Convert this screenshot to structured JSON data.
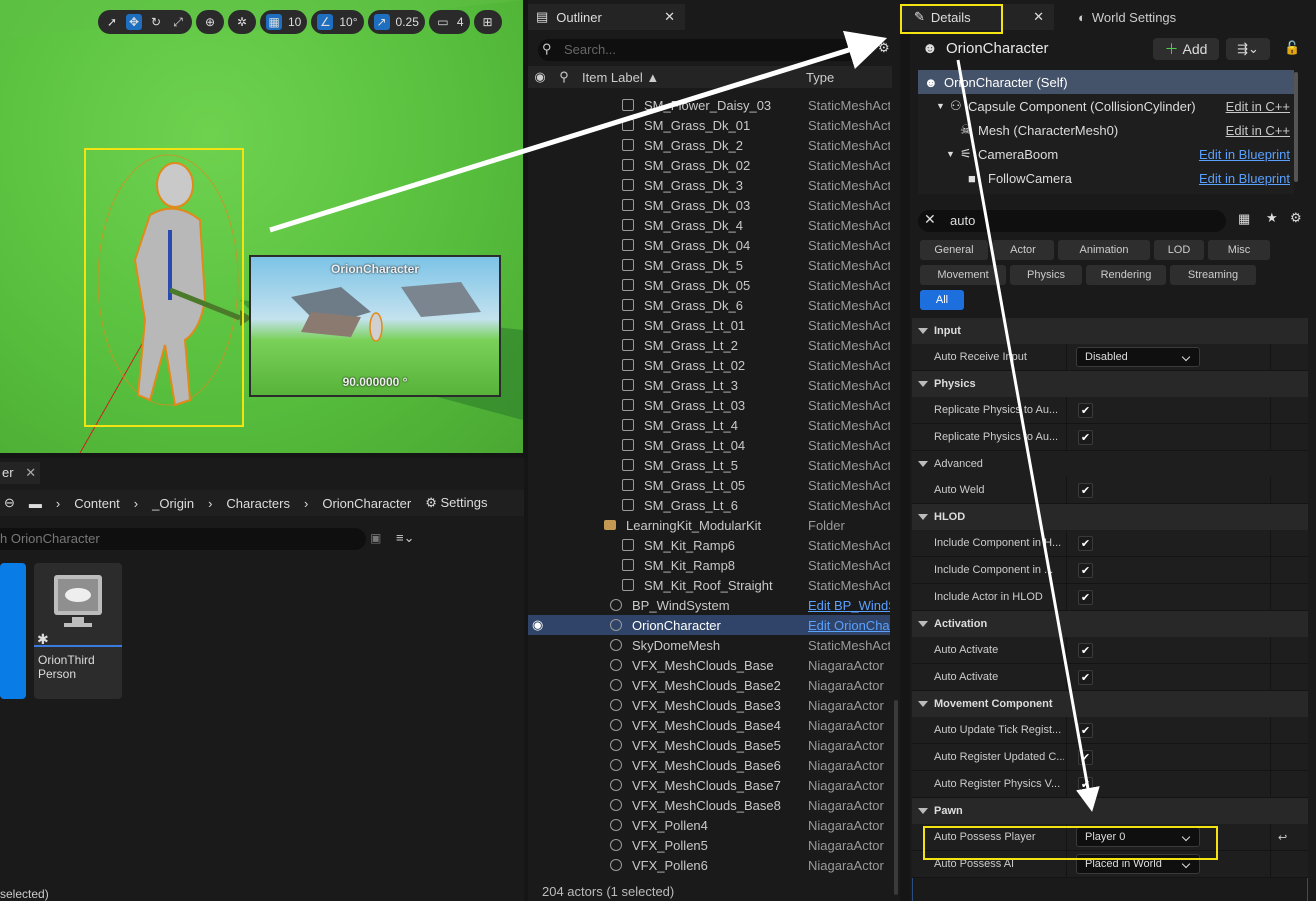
{
  "viewport": {
    "toolbar": {
      "grid_value": "10",
      "angle_value": "10°",
      "scale_value": "0.25",
      "camera_speed": "4"
    },
    "pip": {
      "title": "OrionCharacter",
      "angle": "90.000000 °"
    }
  },
  "content_browser": {
    "tab": "er",
    "path": [
      "Content",
      "_Origin",
      "Characters",
      "OrionCharacter"
    ],
    "settings_label": "Settings",
    "search_placeholder": "h OrionCharacter",
    "asset_label": "OrionThird Person",
    "status": "selected)"
  },
  "outliner": {
    "tab_title": "Outliner",
    "search_placeholder": "Search...",
    "col_label": "Item Label",
    "col_type": "Type",
    "rows": [
      {
        "name": "SM_Flower_Daisy_03",
        "type": "StaticMeshAct"
      },
      {
        "name": "SM_Grass_Dk_01",
        "type": "StaticMeshAct"
      },
      {
        "name": "SM_Grass_Dk_2",
        "type": "StaticMeshAct"
      },
      {
        "name": "SM_Grass_Dk_02",
        "type": "StaticMeshAct"
      },
      {
        "name": "SM_Grass_Dk_3",
        "type": "StaticMeshAct"
      },
      {
        "name": "SM_Grass_Dk_03",
        "type": "StaticMeshAct"
      },
      {
        "name": "SM_Grass_Dk_4",
        "type": "StaticMeshAct"
      },
      {
        "name": "SM_Grass_Dk_04",
        "type": "StaticMeshAct"
      },
      {
        "name": "SM_Grass_Dk_5",
        "type": "StaticMeshAct"
      },
      {
        "name": "SM_Grass_Dk_05",
        "type": "StaticMeshAct"
      },
      {
        "name": "SM_Grass_Dk_6",
        "type": "StaticMeshAct"
      },
      {
        "name": "SM_Grass_Lt_01",
        "type": "StaticMeshAct"
      },
      {
        "name": "SM_Grass_Lt_2",
        "type": "StaticMeshAct"
      },
      {
        "name": "SM_Grass_Lt_02",
        "type": "StaticMeshAct"
      },
      {
        "name": "SM_Grass_Lt_3",
        "type": "StaticMeshAct"
      },
      {
        "name": "SM_Grass_Lt_03",
        "type": "StaticMeshAct"
      },
      {
        "name": "SM_Grass_Lt_4",
        "type": "StaticMeshAct"
      },
      {
        "name": "SM_Grass_Lt_04",
        "type": "StaticMeshAct"
      },
      {
        "name": "SM_Grass_Lt_5",
        "type": "StaticMeshAct"
      },
      {
        "name": "SM_Grass_Lt_05",
        "type": "StaticMeshAct"
      },
      {
        "name": "SM_Grass_Lt_6",
        "type": "StaticMeshAct"
      },
      {
        "name": "LearningKit_ModularKit",
        "type": "Folder"
      },
      {
        "name": "SM_Kit_Ramp6",
        "type": "StaticMeshAct"
      },
      {
        "name": "SM_Kit_Ramp8",
        "type": "StaticMeshAct"
      },
      {
        "name": "SM_Kit_Roof_Straight",
        "type": "StaticMeshAct"
      },
      {
        "name": "BP_WindSystem",
        "type": "Edit BP_WindS"
      },
      {
        "name": "OrionCharacter",
        "type": "Edit OrionChar"
      },
      {
        "name": "SkyDomeMesh",
        "type": "StaticMeshAct"
      },
      {
        "name": "VFX_MeshClouds_Base",
        "type": "NiagaraActor"
      },
      {
        "name": "VFX_MeshClouds_Base2",
        "type": "NiagaraActor"
      },
      {
        "name": "VFX_MeshClouds_Base3",
        "type": "NiagaraActor"
      },
      {
        "name": "VFX_MeshClouds_Base4",
        "type": "NiagaraActor"
      },
      {
        "name": "VFX_MeshClouds_Base5",
        "type": "NiagaraActor"
      },
      {
        "name": "VFX_MeshClouds_Base6",
        "type": "NiagaraActor"
      },
      {
        "name": "VFX_MeshClouds_Base7",
        "type": "NiagaraActor"
      },
      {
        "name": "VFX_MeshClouds_Base8",
        "type": "NiagaraActor"
      },
      {
        "name": "VFX_Pollen4",
        "type": "NiagaraActor"
      },
      {
        "name": "VFX_Pollen5",
        "type": "NiagaraActor"
      },
      {
        "name": "VFX_Pollen6",
        "type": "NiagaraActor"
      }
    ],
    "status": "204 actors (1 selected)"
  },
  "details": {
    "tab_title": "Details",
    "world_settings_tab": "World Settings",
    "actor_name": "OrionCharacter",
    "add_label": "Add",
    "components": [
      {
        "name": "OrionCharacter (Self)",
        "link": ""
      },
      {
        "name": "Capsule Component (CollisionCylinder)",
        "link": "Edit in C++"
      },
      {
        "name": "Mesh (CharacterMesh0)",
        "link": "Edit in C++"
      },
      {
        "name": "CameraBoom",
        "link": "Edit in Blueprint"
      },
      {
        "name": "FollowCamera",
        "link": "Edit in Blueprint"
      }
    ],
    "search_value": "auto",
    "filters": [
      "General",
      "Actor",
      "Animation",
      "LOD",
      "Misc",
      "Movement",
      "Physics",
      "Rendering",
      "Streaming",
      "All"
    ],
    "categories": {
      "input": "Input",
      "physics": "Physics",
      "advanced": "Advanced",
      "hlod": "HLOD",
      "activation": "Activation",
      "movement": "Movement Component",
      "pawn": "Pawn"
    },
    "props": {
      "auto_receive_input": "Auto Receive Input",
      "auto_receive_input_value": "Disabled",
      "replicate1": "Replicate Physics to Au...",
      "replicate2": "Replicate Physics to Au...",
      "auto_weld": "Auto Weld",
      "include1": "Include Component in H...",
      "include2": "Include Component in ...",
      "include_actor": "Include Actor in HLOD",
      "auto_activate1": "Auto Activate",
      "auto_activate2": "Auto Activate",
      "auto_update_tick": "Auto Update Tick Regist...",
      "auto_register_updated": "Auto Register Updated C...",
      "auto_register_physics": "Auto Register Physics V...",
      "auto_possess_player": "Auto Possess Player",
      "auto_possess_player_value": "Player 0",
      "auto_possess_ai": "Auto Possess AI",
      "auto_possess_ai_value": "Placed in World"
    }
  },
  "colors": {
    "highlight": "#f3e313",
    "accent": "#1e6fde",
    "selection": "#2f4468"
  }
}
